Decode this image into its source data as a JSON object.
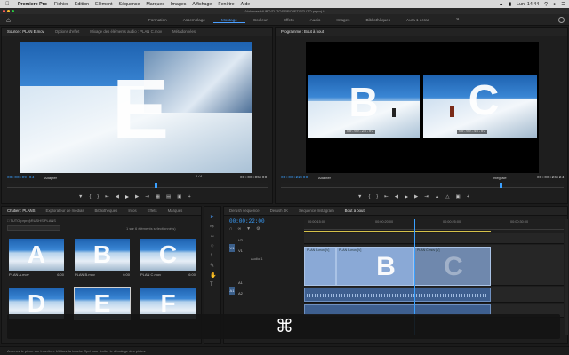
{
  "menubar": {
    "app": "Premiere Pro",
    "items": [
      "Fichier",
      "Edition",
      "Elément",
      "Séquence",
      "Marques",
      "Images",
      "Affichage",
      "Fenêtre",
      "Aide"
    ],
    "clock": "Lun. 14:44"
  },
  "window": {
    "title": "/Volumes/HUBO/TUTOS/PROJETS/TUTO.prproj *"
  },
  "workspace": {
    "tabs": [
      "Formation",
      "Assemblage",
      "Montage",
      "Couleur",
      "Effets",
      "Audio",
      "Images",
      "Bibliothèques",
      "Aura 1 écran"
    ],
    "active": "Montage",
    "more": "»"
  },
  "source": {
    "tabs": [
      "Source : PLAN E.mov",
      "Options d'effet",
      "Mixage des éléments audio : PLAN C.mov",
      "Métadonnées"
    ],
    "letter": "E",
    "timecode_left": "00:00:09:04",
    "fit": "Adapter",
    "fraction": "1/4",
    "timecode_right": "00:00:05:00"
  },
  "program": {
    "tabs": [
      "Programme : Bout à bout"
    ],
    "letter_left": "B",
    "letter_right": "C",
    "tc_left": "00:00:28:03",
    "tc_right": "00:00:45:03",
    "timecode_left": "00:00:22:00",
    "fit": "Adapter",
    "quality": "Intégrale",
    "timecode_right": "00:00:26:24"
  },
  "project": {
    "tabs": [
      "Chutier : PLANS",
      "Explorateur de médias",
      "Bibliothèques",
      "Infos",
      "Effets",
      "Marques"
    ],
    "path": "TUTO.prproj\\RUSHS\\PLANS",
    "count": "1 sur 6 éléments sélectionné(s)",
    "items": [
      {
        "letter": "A",
        "name": "PLAN A.mov",
        "dur": "6:00"
      },
      {
        "letter": "B",
        "name": "PLAN B.mov",
        "dur": "6:00"
      },
      {
        "letter": "C",
        "name": "PLAN C.mov",
        "dur": "6:00"
      },
      {
        "letter": "D",
        "name": "",
        "dur": ""
      },
      {
        "letter": "E",
        "name": "",
        "dur": ""
      },
      {
        "letter": "F",
        "name": "",
        "dur": ""
      }
    ]
  },
  "timeline": {
    "tabs": [
      "Derush séquence",
      "Derush 4K",
      "Séquence Instagram",
      "Bout à bout"
    ],
    "active": "Bout à bout",
    "timecode": "00:00:22:00",
    "ruler": [
      "00:00:15:00",
      "00:00:20:00",
      "00:00:25:00",
      "00:00:30:00"
    ],
    "tracks": [
      "V2",
      "V1",
      "A1",
      "A2"
    ],
    "clip_labels": [
      "PLAN B.mov [V]",
      "PLAN B.mov [V]",
      "PLAN C.mov [V]"
    ],
    "clip_letter_b": "B",
    "clip_letter_c": "C",
    "track_label": "Audio 1"
  },
  "overlay": {
    "symbol": "⌘"
  },
  "status": "Amenez le pince sur Insertion. Utilisez la touche Cpd pour limiter le décalage des pistes."
}
